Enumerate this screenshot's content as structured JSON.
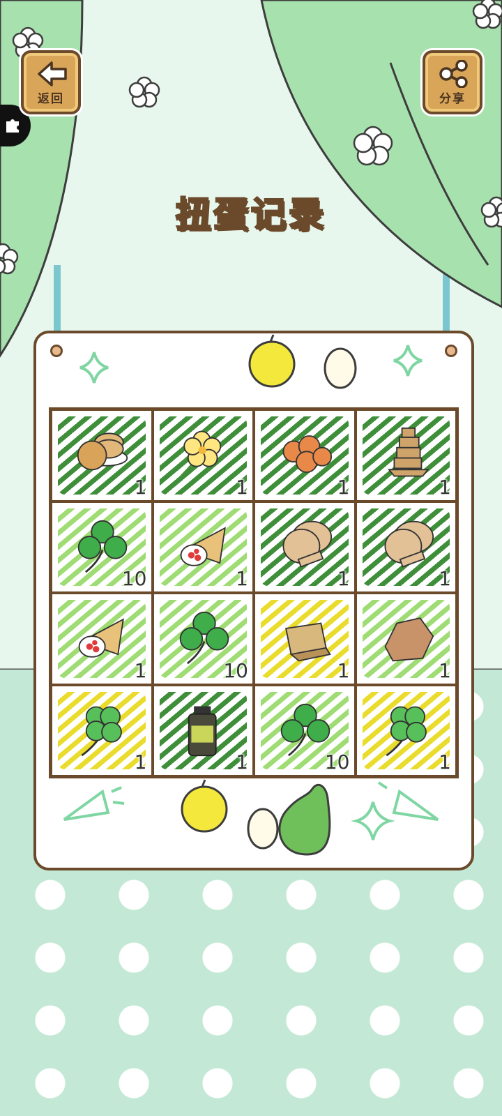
{
  "title": "扭蛋记录",
  "buttons": {
    "back": "返回",
    "share": "分享"
  },
  "colors": {
    "curtain": "#a7e1ae",
    "wall": "#e8f7ee",
    "floor": "#c3e9d6",
    "frame": "#6b4a2b",
    "button": "#d9a659"
  },
  "items": [
    {
      "icon": "rice-crackers-icon",
      "bg": "dark-green",
      "count": "1"
    },
    {
      "icon": "yellow-flower-icon",
      "bg": "dark-green",
      "count": "1"
    },
    {
      "icon": "orange-buns-icon",
      "bg": "dark-green",
      "count": "1"
    },
    {
      "icon": "stacked-cookies-icon",
      "bg": "dark-green",
      "count": "1"
    },
    {
      "icon": "three-leaf-clover-icon",
      "bg": "light-green",
      "count": "10"
    },
    {
      "icon": "strawberry-crepe-icon",
      "bg": "light-green",
      "count": "1"
    },
    {
      "icon": "sesame-crackers-icon",
      "bg": "dark-green",
      "count": "1"
    },
    {
      "icon": "sesame-crackers-icon",
      "bg": "dark-green",
      "count": "1"
    },
    {
      "icon": "strawberry-crepe-icon",
      "bg": "light-green",
      "count": "1"
    },
    {
      "icon": "three-leaf-clover-icon",
      "bg": "light-green",
      "count": "10"
    },
    {
      "icon": "wooden-box-icon",
      "bg": "yellow",
      "count": "1"
    },
    {
      "icon": "brown-stone-icon",
      "bg": "light-green",
      "count": "1"
    },
    {
      "icon": "four-leaf-clover-icon",
      "bg": "yellow",
      "count": "1"
    },
    {
      "icon": "medicine-bottle-icon",
      "bg": "dark-green",
      "count": "1"
    },
    {
      "icon": "three-leaf-clover-icon",
      "bg": "light-green",
      "count": "10"
    },
    {
      "icon": "four-leaf-clover-icon",
      "bg": "yellow",
      "count": "1"
    }
  ]
}
